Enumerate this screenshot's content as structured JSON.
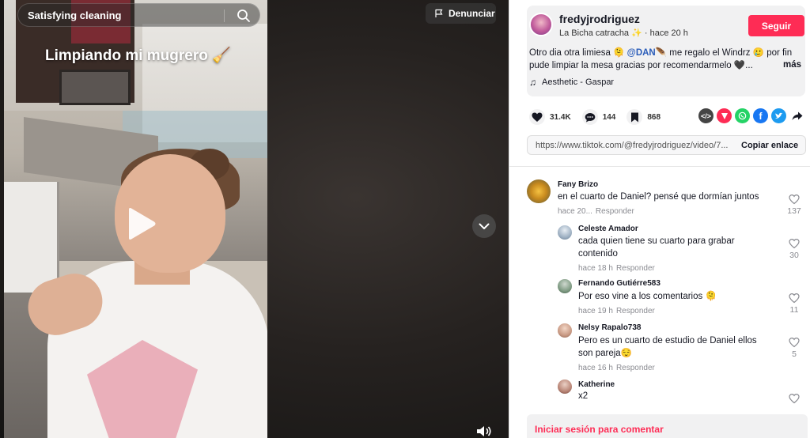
{
  "video": {
    "search_text": "Satisfying cleaning",
    "caption_overlay": "Limpiando mi mugrero 🧹",
    "report_label": "Denunciar"
  },
  "post": {
    "username": "fredyjrodriguez",
    "subline": "La Bicha catracha ✨ · hace 20 h",
    "follow_label": "Seguir",
    "desc_part1": "Otro dia otra limiesa 🫠 ",
    "mention": "@DAN🪶",
    "desc_part2": " me regalo el Windrz 🥲 por fin pude limpiar la mesa gracias por recomendarmelo 🖤...",
    "more_label": "más",
    "music": "Aesthetic - Gaspar"
  },
  "stats": {
    "likes": "31.4K",
    "comments": "144",
    "saves": "868"
  },
  "share": {
    "link": "https://www.tiktok.com/@fredyjrodriguez/video/7...",
    "copy_label": "Copiar enlace"
  },
  "comments": [
    {
      "name": "Fany Brizo",
      "text": "en el cuarto de Daniel? pensé que dormían juntos",
      "time": "hace 20...",
      "reply": "Responder",
      "likes": "137"
    },
    {
      "name": "Celeste Amador",
      "text": "cada quien tiene su cuarto para grabar contenido",
      "time": "hace 18 h",
      "reply": "Responder",
      "likes": "30"
    },
    {
      "name": "Fernando Gutiérre583",
      "text": "Por eso vine a los comentarios 🫠",
      "time": "hace 19 h",
      "reply": "Responder",
      "likes": "11"
    },
    {
      "name": "Nelsy Rapalo738",
      "text": "Pero es un cuarto de estudio de Daniel ellos son pareja😌",
      "time": "hace 16 h",
      "reply": "Responder",
      "likes": "5"
    },
    {
      "name": "Katherine",
      "text": "x2",
      "time": "",
      "reply": "",
      "likes": ""
    }
  ],
  "login": {
    "label": "Iniciar sesión para comentar"
  },
  "colors": {
    "accent": "#fe2c55",
    "mention": "#2b5db9"
  }
}
